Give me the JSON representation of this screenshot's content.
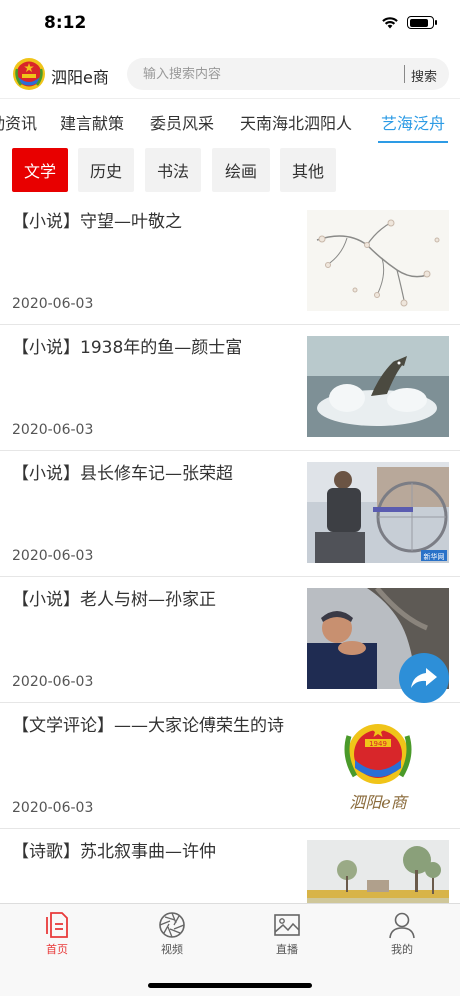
{
  "status_bar": {
    "time": "8:12",
    "battery_level": 0.9
  },
  "header": {
    "app_name": "泗阳e商",
    "logo_icon": "cppcc-emblem-icon"
  },
  "search": {
    "placeholder": "输入搜索内容",
    "button_label": "搜索"
  },
  "tabs": [
    {
      "label": "动资讯",
      "active": false
    },
    {
      "label": "建言献策",
      "active": false
    },
    {
      "label": "委员风采",
      "active": false
    },
    {
      "label": "天南海北泗阳人",
      "active": false
    },
    {
      "label": "艺海泛舟",
      "active": true
    }
  ],
  "filters": [
    {
      "label": "文学",
      "active": true
    },
    {
      "label": "历史",
      "active": false
    },
    {
      "label": "书法",
      "active": false
    },
    {
      "label": "绘画",
      "active": false
    },
    {
      "label": "其他",
      "active": false
    }
  ],
  "articles": [
    {
      "title": "【小说】守望—叶敬之",
      "date": "2020-06-03",
      "thumb": "plum-blossom-image"
    },
    {
      "title": "【小说】1938年的鱼—颜士富",
      "date": "2020-06-03",
      "thumb": "jumping-fish-image"
    },
    {
      "title": "【小说】县长修车记—张荣超",
      "date": "2020-06-03",
      "thumb": "bicycle-repair-image",
      "thumb_caption": "新华网"
    },
    {
      "title": "【小说】老人与树—孙家正",
      "date": "2020-06-03",
      "thumb": "old-man-tree-image"
    },
    {
      "title": "【文学评论】——大家论傅荣生的诗",
      "date": "2020-06-03",
      "thumb": "cppcc-logo-image",
      "thumb_caption": "泗阳e商",
      "emblem_year": "1949"
    },
    {
      "title": "【诗歌】苏北叙事曲—许仲",
      "date": "",
      "thumb": "rural-landscape-image"
    }
  ],
  "share_button": {
    "icon": "share-arrow-icon"
  },
  "tabbar": [
    {
      "label": "首页",
      "icon": "document-icon",
      "active": true
    },
    {
      "label": "视频",
      "icon": "aperture-icon",
      "active": false
    },
    {
      "label": "直播",
      "icon": "image-icon",
      "active": false
    },
    {
      "label": "我的",
      "icon": "person-icon",
      "active": false
    }
  ],
  "colors": {
    "accent_blue": "#2d9be5",
    "active_red": "#e80000",
    "tab_active_red": "#e83a3a",
    "share_blue": "#2d8fd8"
  }
}
